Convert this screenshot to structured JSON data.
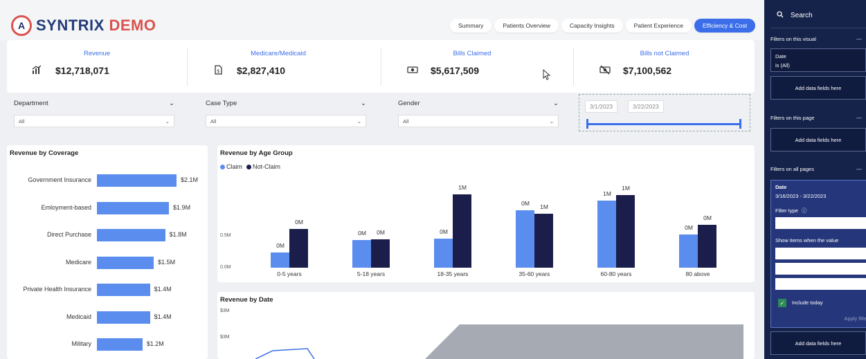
{
  "app": {
    "brand_main": "SYNTRIX",
    "brand_accent": "DEMO",
    "brand_badge": "A"
  },
  "tabs": [
    {
      "label": "Summary"
    },
    {
      "label": "Patients Overview"
    },
    {
      "label": "Capacity Insights"
    },
    {
      "label": "Patient Experience"
    },
    {
      "label": "Efficiency & Cost",
      "active": true
    }
  ],
  "kpis": [
    {
      "label": "Revenue",
      "value": "$12,718,071",
      "icon": "revenue-chart-icon"
    },
    {
      "label": "Medicare/Medicaid",
      "value": "$2,827,410",
      "icon": "document-dollar-icon"
    },
    {
      "label": "Bills Claimed",
      "value": "$5,617,509",
      "icon": "money-icon"
    },
    {
      "label": "Bills not Claimed",
      "value": "$7,100,562",
      "icon": "money-off-icon"
    }
  ],
  "slicers": [
    {
      "label": "Department",
      "value": "All"
    },
    {
      "label": "Case Type",
      "value": "All"
    },
    {
      "label": "Gender",
      "value": "All"
    }
  ],
  "date_slicer": {
    "start": "3/1/2023",
    "end": "3/22/2023"
  },
  "colors": {
    "claim": "#5b8def",
    "not_claim": "#1b1e4a",
    "accent": "#3b6ee8",
    "filter_pane": "#15224a"
  },
  "coverage_chart": {
    "title": "Revenue by Coverage",
    "chart_data": {
      "type": "bar",
      "orientation": "horizontal",
      "categories": [
        "Government Insurance",
        "Emloyment-based",
        "Direct Purchase",
        "Medicare",
        "Private Health Insurance",
        "Medicaid",
        "Military"
      ],
      "values": [
        2.1,
        1.9,
        1.8,
        1.5,
        1.4,
        1.4,
        1.2
      ],
      "labels": [
        "$2.1M",
        "$1.9M",
        "$1.8M",
        "$1.5M",
        "$1.4M",
        "$1.4M",
        "$1.2M"
      ],
      "unit": "M"
    }
  },
  "age_chart": {
    "title": "Revenue by Age Group",
    "chart_data": {
      "type": "bar",
      "categories": [
        "0-5 years",
        "5-18 years",
        "18-35 years",
        "35-60 years",
        "60-80 years",
        "80 above"
      ],
      "series": [
        {
          "name": "Claim",
          "values": [
            0.24,
            0.43,
            0.45,
            0.9,
            1.05,
            0.52
          ],
          "labels": [
            "0M",
            "0M",
            "0M",
            "0M",
            "1M",
            "0M"
          ]
        },
        {
          "name": "Not-Claim",
          "values": [
            0.61,
            0.44,
            1.15,
            0.85,
            1.14,
            0.67
          ],
          "labels": [
            "0M",
            "0M",
            "1M",
            "1M",
            "1M",
            "0M"
          ]
        }
      ],
      "ytick_labels": [
        "0.0M",
        "0.5M"
      ],
      "yticks": [
        0,
        0.5
      ],
      "ylim": [
        0,
        1.3
      ]
    }
  },
  "date_chart": {
    "title": "Revenue by Date",
    "ytick_labels": [
      "$3M",
      "$3M"
    ]
  },
  "filter_pane": {
    "search_label": "Search",
    "section_visual": "Filters on this visual",
    "visual_filter_field": "Date",
    "visual_filter_value": "is (All)",
    "add_fields": "Add data fields here",
    "section_page": "Filters on this page",
    "section_all": "Filters on all pages",
    "all_filter_field": "Date",
    "all_filter_value": "3/16/2023 - 3/22/2023",
    "filter_type_label": "Filter type",
    "show_items_label": "Show items when the value",
    "include_today": "Include today",
    "apply_filter": "Apply filte"
  }
}
